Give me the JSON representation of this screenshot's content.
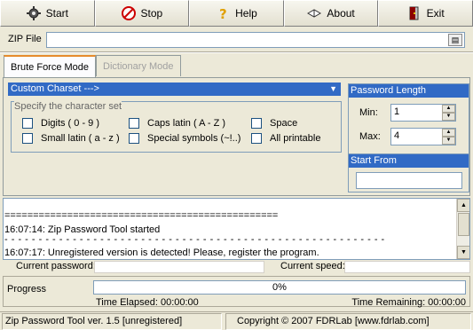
{
  "toolbar": {
    "buttons": [
      {
        "label": "Start",
        "icon": "gear-icon"
      },
      {
        "label": "Stop",
        "icon": "stop-icon"
      },
      {
        "label": "Help",
        "icon": "question-icon"
      },
      {
        "label": "About",
        "icon": "book-icon"
      },
      {
        "label": "Exit",
        "icon": "exit-door-icon"
      }
    ]
  },
  "zip": {
    "label": "ZIP File",
    "value": ""
  },
  "tabs": [
    {
      "label": "Brute Force Mode",
      "active": true
    },
    {
      "label": "Dictionary Mode",
      "active": false
    }
  ],
  "charset": {
    "selected": "Custom Charset  --->"
  },
  "spec": {
    "title": "Specify the character set",
    "options": [
      {
        "label": "Digits ( 0 - 9 )",
        "checked": false
      },
      {
        "label": "Caps latin ( A - Z )",
        "checked": false
      },
      {
        "label": "Space",
        "checked": false
      },
      {
        "label": "Small latin ( a - z )",
        "checked": false
      },
      {
        "label": "Special symbols (~!..)",
        "checked": false
      },
      {
        "label": "All printable",
        "checked": false
      }
    ]
  },
  "password_length": {
    "title": "Password Length",
    "min_label": "Min:",
    "min_value": "1",
    "max_label": "Max:",
    "max_value": "4"
  },
  "start_from": {
    "title": "Start From",
    "value": ""
  },
  "log": {
    "lines": [
      "================================================",
      "16:07:14: Zip Password Tool started",
      "- - - - - - - - - - - - - - - - - - - - - - - - - - - - - - - - - - - - - - - - - - - - - - - - - - - - - - - -",
      "16:07:17: Unregistered version is detected! Please, register the program."
    ]
  },
  "current": {
    "password_label": "Current password:",
    "password_value": "",
    "speed_label": "Current speed:",
    "speed_value": ""
  },
  "progress": {
    "label": "Progress",
    "percent_text": "0%",
    "fraction": 0,
    "elapsed": "Time Elapsed: 00:00:00",
    "remaining": "Time Remaining: 00:00:00"
  },
  "status": {
    "left": "Zip Password Tool ver. 1.5 [unregistered]",
    "right": "Copyright © 2007 FDRLab [www.fdrlab.com]"
  }
}
